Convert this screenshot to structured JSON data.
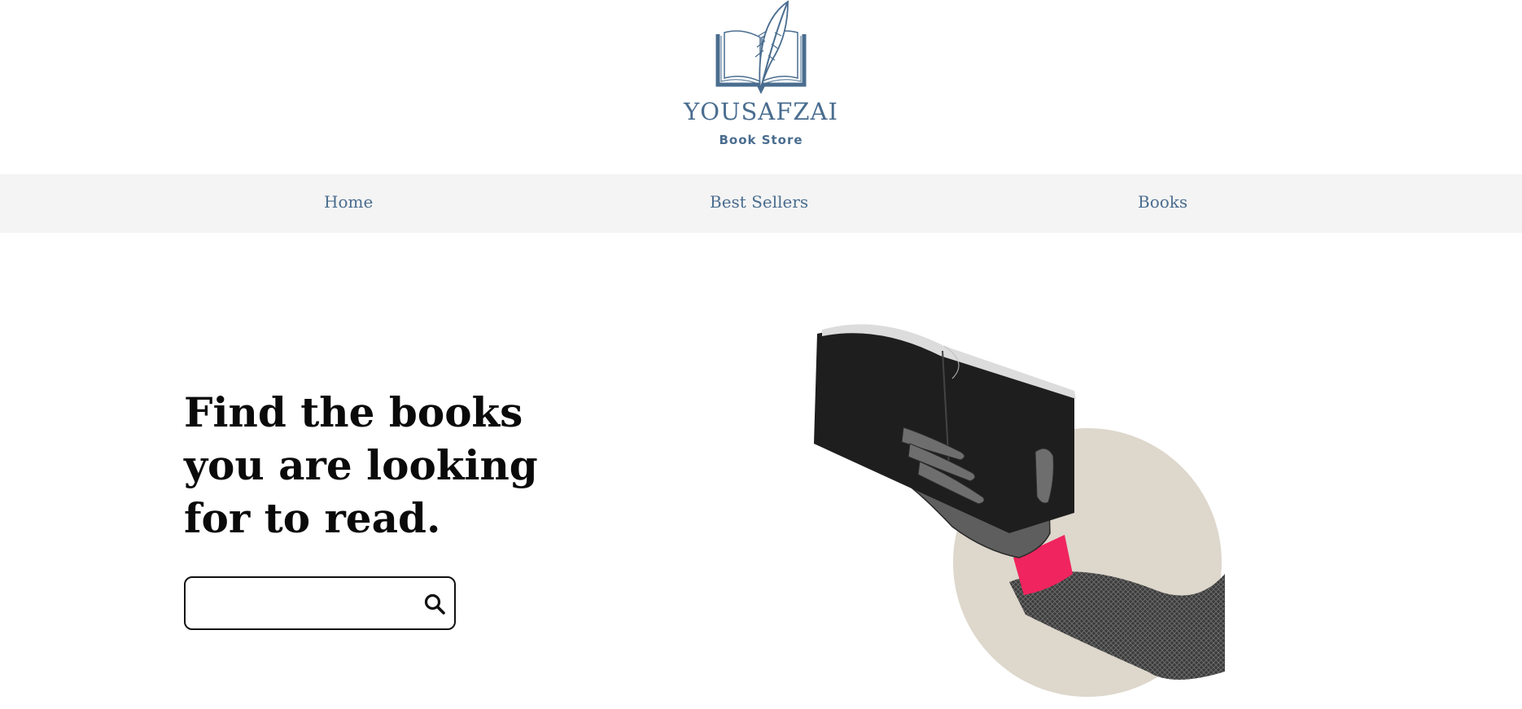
{
  "brand": {
    "name": "YOUSAFZAI",
    "tagline": "Book Store"
  },
  "nav": {
    "items": [
      {
        "label": "Home"
      },
      {
        "label": "Best Sellers"
      },
      {
        "label": "Books"
      }
    ]
  },
  "hero": {
    "title_lines": [
      "Find the books",
      "you are looking",
      "for to read."
    ],
    "search": {
      "value": "",
      "placeholder": ""
    }
  },
  "colors": {
    "brand": "#4a6d8f",
    "nav_bg": "#f4f4f4",
    "text": "#0a0a0a",
    "accent_cuff": "#f0245e",
    "circle": "#ddd7cc"
  },
  "icons": {
    "logo": "book-quill-icon",
    "search": "search-icon"
  }
}
